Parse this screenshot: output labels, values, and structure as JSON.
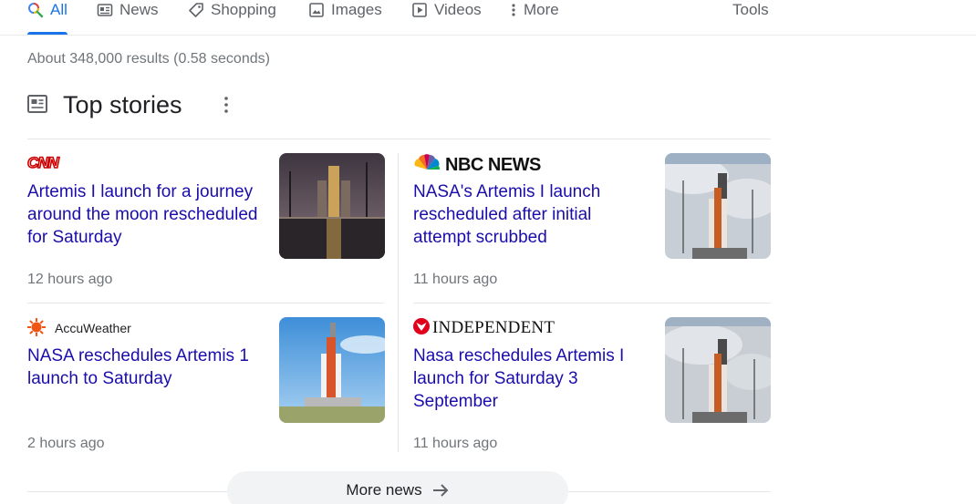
{
  "tabs": [
    {
      "label": "All",
      "icon": "search-icon",
      "active": true
    },
    {
      "label": "News",
      "icon": "news-icon"
    },
    {
      "label": "Shopping",
      "icon": "tag-icon"
    },
    {
      "label": "Images",
      "icon": "image-icon"
    },
    {
      "label": "Videos",
      "icon": "play-icon"
    },
    {
      "label": "More",
      "icon": "vertical-dots-icon"
    }
  ],
  "tools_label": "Tools",
  "result_stats": "About 348,000 results (0.58 seconds)",
  "top_stories": {
    "title": "Top stories",
    "icon": "newspaper-icon",
    "stories": [
      {
        "source": "CNN",
        "headline": "Artemis I launch for a journey around the moon rescheduled for Saturday",
        "time": "12 hours ago"
      },
      {
        "source": "NBC NEWS",
        "headline": "NASA's Artemis I launch rescheduled after initial attempt scrubbed",
        "time": "11 hours ago"
      },
      {
        "source": "AccuWeather",
        "headline": "NASA reschedules Artemis 1 launch to Saturday",
        "time": "2 hours ago"
      },
      {
        "source": "INDEPENDENT",
        "headline": "Nasa reschedules Artemis I launch for Saturday 3 September",
        "time": "11 hours ago"
      }
    ]
  },
  "more_news_label": "More news",
  "colors": {
    "link": "#1a0dab",
    "accent": "#1a73e8",
    "muted": "#70757a",
    "cnn_red": "#cc0000",
    "independent_red": "#e0001b",
    "accuweather_orange": "#f05514"
  }
}
